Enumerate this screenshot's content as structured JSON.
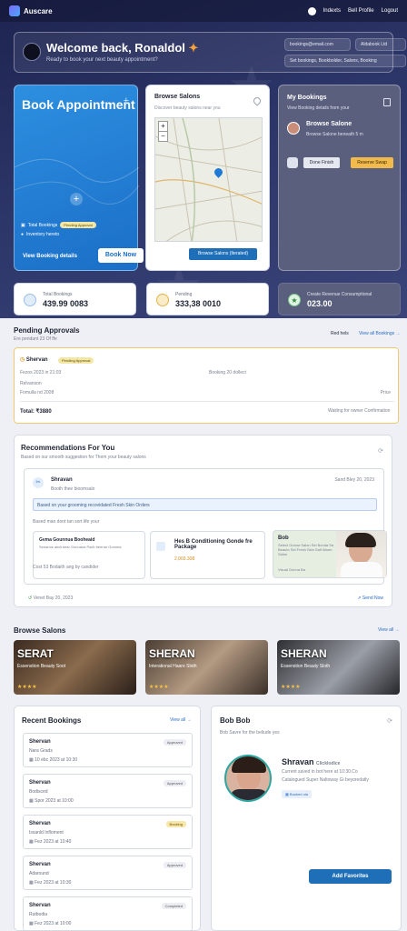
{
  "topbar": {
    "brand": "Auscare",
    "nav": [
      "Indexts",
      "Bell Profile",
      "Logout"
    ]
  },
  "welcome": {
    "title": "Welcome back, Ronaldol",
    "subtitle": "Ready to book your next beauty appointment?",
    "chips": [
      "bookings@email.com",
      "Aldabook Ltd",
      "Set bookings, Bookbolder, Salons, Booking"
    ]
  },
  "book": {
    "title": "Book Appointment",
    "line1": "Total Bookings",
    "badge": "Pending Approval",
    "line2": "Inventory hereto",
    "link": "View Booking details",
    "button": "Book Now"
  },
  "salons": {
    "title": "Browse Salons",
    "subtitle": "Discover beauty salons near you",
    "button": "Browse Salons (Iterated)"
  },
  "mybookings": {
    "title": "My Bookings",
    "subtitle": "View Booking details from your",
    "name": "Browse Salone",
    "detail": "Browse Salone beneath 5 m",
    "button1": "Done Finish",
    "button2": "Reserve Swap"
  },
  "stats": [
    {
      "label": "Total Bookings",
      "value": "439.99 0083"
    },
    {
      "label": "Pending",
      "value": "333,38 0010"
    },
    {
      "label": "Create Revenue Consumptional",
      "value": "023.00"
    }
  ],
  "pending": {
    "title": "Pending Approvals",
    "subtitle": "Ere pendant 23 Of ffe",
    "filter": "Red hels",
    "viewall": "View all Bookings →",
    "name": "Shervan",
    "badge": "Pending Approval",
    "date": "Fezos 2023 in 21:03",
    "service": "Booking 20 dollect",
    "l3": "Relvanson",
    "l4": "Fomulla nd 2008",
    "right4": "Price",
    "total": "Total: ₹3880",
    "waiting": "Waiting for owner Confirmation"
  },
  "rec": {
    "title": "Recommendations For You",
    "subtitle": "Based on our smooth suggestion for Them your beauty salons",
    "name": "Shravan",
    "meta": "Booth thee bioomsalo",
    "date": "Sand Bley 20, 2023",
    "alert": "Based on your grooming recovidated Fresh Skin Orders",
    "desc": "Based man dont tan sort life your",
    "c1t": "Gvma Gounnua Booheaid",
    "c1s": "Senarios abdt bear Gonnana Pacb beenar Gomma",
    "c2t": "Hes B Conditioning Gonde fre Package",
    "c2p": "2,003.308",
    "c3t": "Bob",
    "c3s": "Select Gonna Salon Sel Bonda Sa Beauto Sel Fresh Skin Salt Warm Salon",
    "c3s2": "Visual Gonna Ba",
    "foot": "Cost 53 Bodaith ang by candider",
    "footdate": "Venet Bay 20, 2023",
    "send": "Send Now"
  },
  "browse": {
    "title": "Browse Salons",
    "viewall": "View all →",
    "cards": [
      {
        "name": "SERAT",
        "sub": "Essenstion Beauty Soot"
      },
      {
        "name": "SHERAN",
        "sub": "Interational Haare Sloth"
      },
      {
        "name": "SHERAN",
        "sub": "Essenstion Beauty Sloth"
      }
    ]
  },
  "recent": {
    "title": "Recent Bookings",
    "viewall": "View all →",
    "items": [
      {
        "name": "Shervan",
        "svc": "Nara Grads",
        "date": "10 ebc 2023 at 10:30",
        "badge": "Approved"
      },
      {
        "name": "Shervan",
        "svc": "Bodisced",
        "date": "Spor 2023 at 10:00",
        "badge": "Approved"
      },
      {
        "name": "Shervan",
        "svc": "Issanld Infloment",
        "date": "Fez 2023 at 10:40",
        "badge": "Booking"
      },
      {
        "name": "Shervan",
        "svc": "Adaround",
        "date": "Fez 2023 at 10:30",
        "badge": "Approved"
      },
      {
        "name": "Shervan",
        "svc": "Rutbodia",
        "date": "Fez 2023 at 10:00",
        "badge": "Completed"
      }
    ]
  },
  "bob": {
    "title": "Bob Bob",
    "subtitle": "Bob Savre for the beliude yes",
    "name": "Shravan",
    "tag": "Clicklodice",
    "d1": "Current saved in bot here at 10:30.Co",
    "d2": "Catalogued Super Naltoway Gi beyoredatly",
    "chip": "Booked ula",
    "button": "Add Favorites"
  }
}
